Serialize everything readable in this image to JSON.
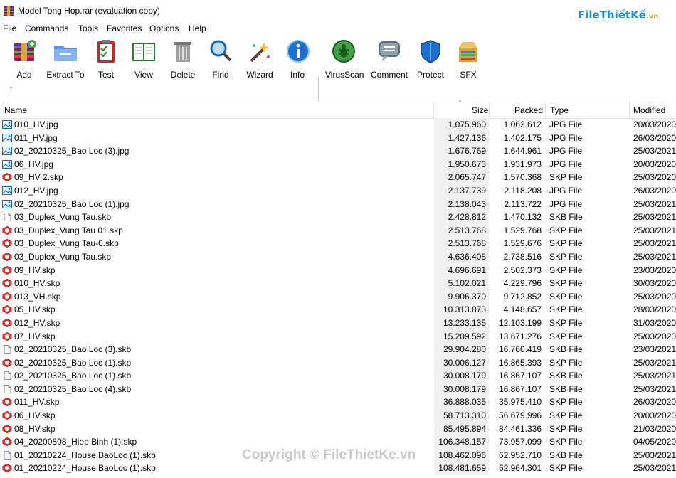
{
  "window": {
    "title": "Model Tong Hop.rar (evaluation copy)"
  },
  "logo": {
    "text": "FileThiếtKế",
    "domain": ".vn"
  },
  "menu": [
    "File",
    "Commands",
    "Tools",
    "Favorites",
    "Options",
    "Help"
  ],
  "toolbar": [
    {
      "label": "Add",
      "icon": "add-archive-icon"
    },
    {
      "label": "Extract To",
      "icon": "extract-folder-icon"
    },
    {
      "label": "Test",
      "icon": "test-clipboard-icon"
    },
    {
      "label": "View",
      "icon": "view-book-icon"
    },
    {
      "label": "Delete",
      "icon": "trash-icon"
    },
    {
      "label": "Find",
      "icon": "magnifier-icon"
    },
    {
      "label": "Wizard",
      "icon": "wizard-wand-icon"
    },
    {
      "label": "Info",
      "icon": "info-icon"
    },
    {
      "label": "VirusScan",
      "icon": "virus-scan-icon"
    },
    {
      "label": "Comment",
      "icon": "comment-icon"
    },
    {
      "label": "Protect",
      "icon": "shield-icon"
    },
    {
      "label": "SFX",
      "icon": "sfx-box-icon"
    }
  ],
  "columns": {
    "name": "Name",
    "size": "Size",
    "packed": "Packed",
    "type": "Type",
    "modified": "Modified"
  },
  "files": [
    {
      "name": "010_HV.jpg",
      "size": "1.075.960",
      "packed": "1.062.612",
      "type": "JPG File",
      "modified": "20/03/2020",
      "kind": "jpg"
    },
    {
      "name": "011_HV.jpg",
      "size": "1.427.136",
      "packed": "1.402.175",
      "type": "JPG File",
      "modified": "26/03/2020",
      "kind": "jpg"
    },
    {
      "name": "02_20210325_Bao Loc (3).jpg",
      "size": "1.676.769",
      "packed": "1.644.961",
      "type": "JPG File",
      "modified": "25/03/2021",
      "kind": "jpg"
    },
    {
      "name": "06_HV.jpg",
      "size": "1.950.673",
      "packed": "1.931.973",
      "type": "JPG File",
      "modified": "20/03/2020",
      "kind": "jpg"
    },
    {
      "name": "09_HV 2.skp",
      "size": "2.065.747",
      "packed": "1.570.368",
      "type": "SKP File",
      "modified": "25/03/2020",
      "kind": "skp"
    },
    {
      "name": "012_HV.jpg",
      "size": "2.137.739",
      "packed": "2.118.208",
      "type": "JPG File",
      "modified": "26/03/2020",
      "kind": "jpg"
    },
    {
      "name": "02_20210325_Bao Loc (1).jpg",
      "size": "2.138.043",
      "packed": "2.113.722",
      "type": "JPG File",
      "modified": "25/03/2021",
      "kind": "jpg"
    },
    {
      "name": "03_Duplex_Vung Tau.skb",
      "size": "2.428.812",
      "packed": "1.470.132",
      "type": "SKB File",
      "modified": "25/03/2021",
      "kind": "skb"
    },
    {
      "name": "03_Duplex_Vung Tau 01.skp",
      "size": "2.513.768",
      "packed": "1.529.768",
      "type": "SKP File",
      "modified": "25/03/2021",
      "kind": "skp"
    },
    {
      "name": "03_Duplex_Vung Tau-0.skp",
      "size": "2.513.768",
      "packed": "1.529.676",
      "type": "SKP File",
      "modified": "25/03/2021",
      "kind": "skp"
    },
    {
      "name": "03_Duplex_Vung Tau.skp",
      "size": "4.636.408",
      "packed": "2.738.516",
      "type": "SKP File",
      "modified": "25/03/2021",
      "kind": "skp"
    },
    {
      "name": "09_HV.skp",
      "size": "4.696.691",
      "packed": "2.502.373",
      "type": "SKP File",
      "modified": "23/03/2020",
      "kind": "skp"
    },
    {
      "name": "010_HV.skp",
      "size": "5.102.021",
      "packed": "4.229.796",
      "type": "SKP File",
      "modified": "30/03/2020",
      "kind": "skp"
    },
    {
      "name": "013_VH.skp",
      "size": "9.906.370",
      "packed": "9.712.852",
      "type": "SKP File",
      "modified": "25/03/2020",
      "kind": "skp"
    },
    {
      "name": "05_HV.skp",
      "size": "10.313.873",
      "packed": "4.148.657",
      "type": "SKP File",
      "modified": "28/03/2020",
      "kind": "skp"
    },
    {
      "name": "012_HV.skp",
      "size": "13.233.135",
      "packed": "12.103.199",
      "type": "SKP File",
      "modified": "31/03/2020",
      "kind": "skp"
    },
    {
      "name": "07_HV.skp",
      "size": "15.209.592",
      "packed": "13.671.276",
      "type": "SKP File",
      "modified": "25/03/2020",
      "kind": "skp"
    },
    {
      "name": "02_20210325_Bao Loc (3).skb",
      "size": "29.904.280",
      "packed": "16.760.419",
      "type": "SKB File",
      "modified": "23/03/2021",
      "kind": "skb"
    },
    {
      "name": "02_20210325_Bao Loc (1).skp",
      "size": "30.006.127",
      "packed": "16.865.393",
      "type": "SKP File",
      "modified": "25/03/2021",
      "kind": "skp"
    },
    {
      "name": "02_20210325_Bao Loc (1).skb",
      "size": "30.008.179",
      "packed": "16.867.107",
      "type": "SKB File",
      "modified": "25/03/2021",
      "kind": "skb"
    },
    {
      "name": "02_20210325_Bao Loc (4).skb",
      "size": "30.008.179",
      "packed": "16.867.107",
      "type": "SKB File",
      "modified": "25/03/2021",
      "kind": "skb"
    },
    {
      "name": "011_HV.skp",
      "size": "36.888.035",
      "packed": "35.975.410",
      "type": "SKP File",
      "modified": "26/03/2020",
      "kind": "skp"
    },
    {
      "name": "06_HV.skp",
      "size": "58.713.310",
      "packed": "56.679.996",
      "type": "SKP File",
      "modified": "20/03/2020",
      "kind": "skp"
    },
    {
      "name": "08_HV.skp",
      "size": "85.495.894",
      "packed": "84.461.336",
      "type": "SKP File",
      "modified": "21/03/2020",
      "kind": "skp"
    },
    {
      "name": "04_20200808_Hiep Binh (1).skp",
      "size": "106.348.157",
      "packed": "73.957.099",
      "type": "SKP File",
      "modified": "04/05/2020",
      "kind": "skp"
    },
    {
      "name": "01_20210224_House BaoLoc (1).skb",
      "size": "108.462.096",
      "packed": "62.952.710",
      "type": "SKB File",
      "modified": "25/03/2021",
      "kind": "skb"
    },
    {
      "name": "01_20210224_House BaoLoc (1).skp",
      "size": "108.481.659",
      "packed": "62.964.301",
      "type": "SKP File",
      "modified": "25/03/2021",
      "kind": "skp"
    }
  ],
  "watermark": "Copyright © FileThietKe.vn"
}
